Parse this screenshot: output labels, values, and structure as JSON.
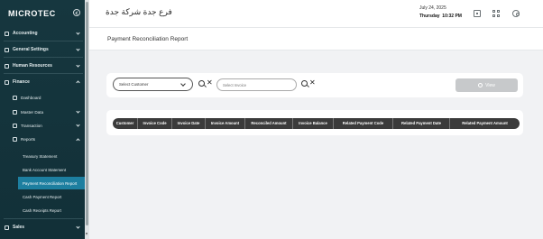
{
  "sidebar": {
    "logo": "MICROTEC",
    "items": {
      "accounting": "Accounting",
      "general_settings": "General Settings",
      "human_resources": "Human Resources",
      "finance": "Finance",
      "dashboard": "Dashboard",
      "master_data": "Master Data",
      "transaction": "Transaction",
      "reports": "Reports",
      "treasury_statement": "Treasury Statement",
      "bank_account_statement": "Bank Account Statement",
      "payment_reconciliation_report": "Payment Reconciliation Report",
      "cash_payment_report": "Cash Payment Report",
      "cash_receipts_report": "Cash Receipts Report",
      "sales": "Sales"
    }
  },
  "header": {
    "company": "فرع جدة شركة جدة",
    "date": "July 24, 2025",
    "day": "Thursday",
    "time": "10:32 PM"
  },
  "page": {
    "title": "Payment Reconciliation Report"
  },
  "filters": {
    "customer_select": "Select Customer",
    "invoice_placeholder": "Select Invoice",
    "view_label": "View"
  },
  "table": {
    "columns": [
      "Customer",
      "Invoice Code",
      "Invoice Date",
      "Invoice Amount",
      "Reconciled Amount",
      "Invoice Balance",
      "Related Payment Code",
      "Related Payment Date",
      "Related Payment Amount"
    ]
  },
  "colors": {
    "sidebar_bg": "#16373f",
    "active_item": "#1d7fa0",
    "table_header": "#3b3b3b",
    "view_button_disabled": "#c7c9cb"
  }
}
